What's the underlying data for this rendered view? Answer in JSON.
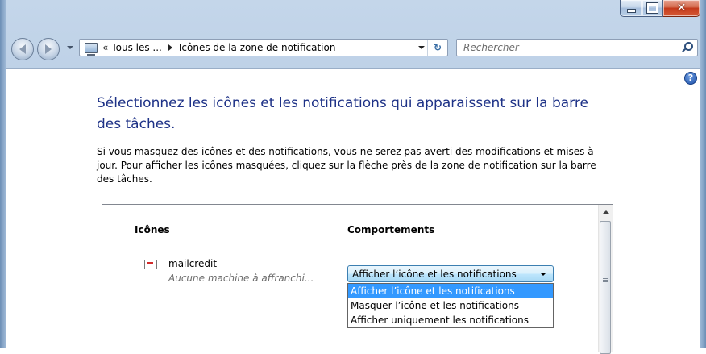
{
  "window": {
    "caption": {
      "minimize_icon": "minimize-icon",
      "maximize_icon": "maximize-icon",
      "close_glyph": "✕"
    }
  },
  "navigation": {
    "address": {
      "overflow_chevron": "«",
      "segment_1": "Tous les ...",
      "segment_2": "Icônes de la zone de notification",
      "refresh_glyph": "↻"
    },
    "search": {
      "placeholder": "Rechercher"
    }
  },
  "page": {
    "help_glyph": "?",
    "title": "Sélectionnez les icônes et les notifications qui apparaissent sur la barre des tâches.",
    "description": "Si vous masquez des icônes et des notifications, vous ne serez pas averti des modifications et mises à jour. Pour afficher les icônes masquées, cliquez sur la flèche près de la zone de notification sur la barre des tâches."
  },
  "table": {
    "headers": {
      "icons": "Icônes",
      "behaviors": "Comportements"
    },
    "rows": [
      {
        "name": "mailcredit",
        "subtitle": "Aucune machine à affranchi...",
        "behavior": "Afficher l’icône et les notifications"
      }
    ],
    "dropdown_options": [
      "Afficher l’icône et les notifications",
      "Masquer l’icône et les notifications",
      "Afficher uniquement les notifications"
    ],
    "selected_option_index": 0
  },
  "colors": {
    "title_blue": "#1e3287",
    "selection_blue": "#3399ff",
    "close_red": "#c3391b"
  }
}
